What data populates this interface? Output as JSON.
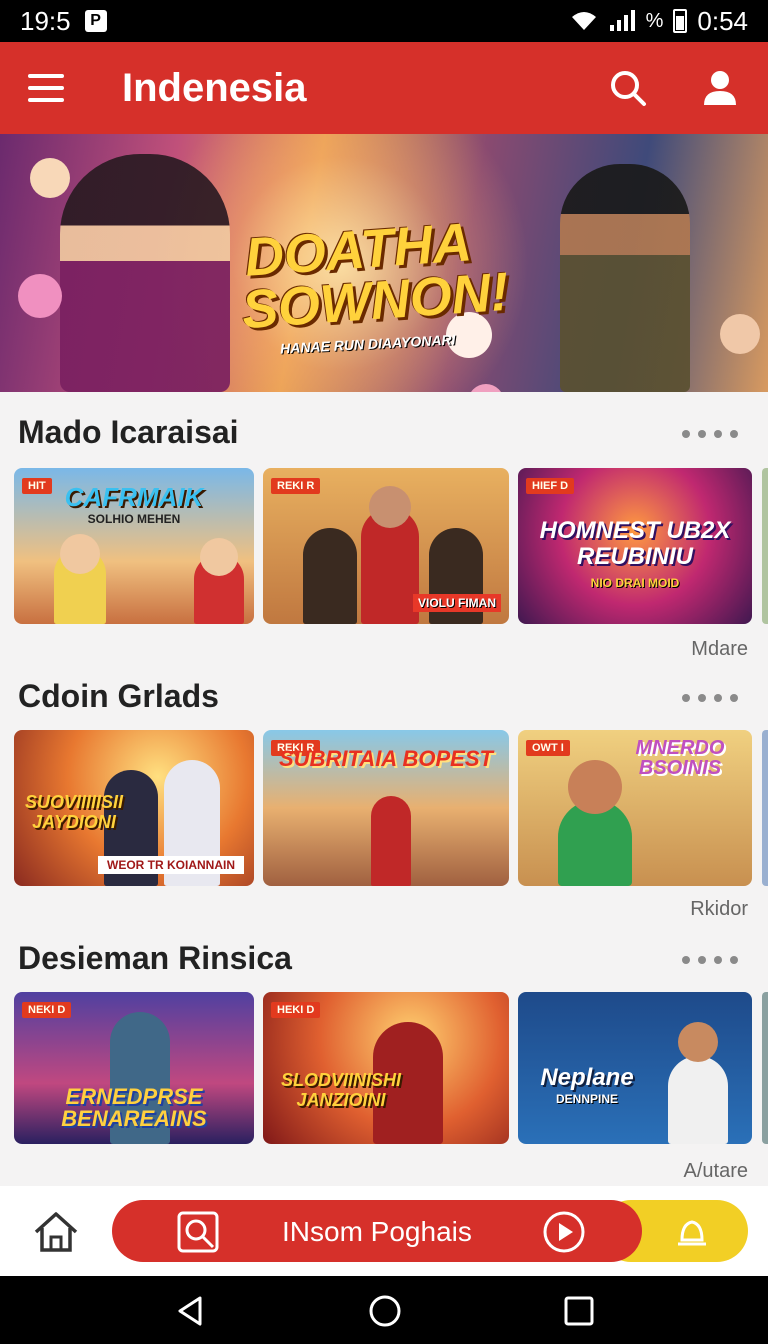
{
  "status_bar": {
    "time": "19:5",
    "right_time": "0:54",
    "battery_text": "%",
    "notif_label": "P"
  },
  "app_bar": {
    "title": "Indenesia"
  },
  "hero": {
    "title": "DOATHA SOWNON!",
    "subtitle": "HANAE RUN DIAAYONARI"
  },
  "sections": [
    {
      "title": "Mado Icaraisai",
      "more": "Mdare",
      "cards": [
        {
          "tag": "HIT",
          "title": "CAFRMAIK",
          "sub": "SOLHIO MEHEN"
        },
        {
          "tag": "REKI R",
          "title": "",
          "sub": "VIOLU FIMAN"
        },
        {
          "tag": "HIEF D",
          "title": "HOMNEST UB2X REUBINIU",
          "sub": "NIO DRAI MOID"
        }
      ]
    },
    {
      "title": "Cdoin Grlads",
      "more": "Rkidor",
      "cards": [
        {
          "tag": "",
          "title": "SUOVIIIIISII JAYDIONI",
          "sub": "WEOR TR KOIANNAIN"
        },
        {
          "tag": "REKI R",
          "title": "SUBRITAIA BOPEST",
          "sub": ""
        },
        {
          "tag": "OWT I",
          "title": "MNERDO BSOINIS",
          "sub": ""
        }
      ]
    },
    {
      "title": "Desieman Rinsica",
      "more": "A/utare",
      "cards": [
        {
          "tag": "NEKI D",
          "title": "ERNEDPRSE BENAREAINS",
          "sub": ""
        },
        {
          "tag": "HEKI D",
          "title": "SLODVIINISHI JANZIOINI",
          "sub": ""
        },
        {
          "tag": "",
          "title": "Neplane",
          "sub": "DENNPINE"
        }
      ]
    }
  ],
  "bottom_nav": {
    "cta_label": "INsom Poghais"
  },
  "colors": {
    "primary": "#d6302a",
    "accent": "#f2cf25",
    "background": "#f4f3f3"
  }
}
